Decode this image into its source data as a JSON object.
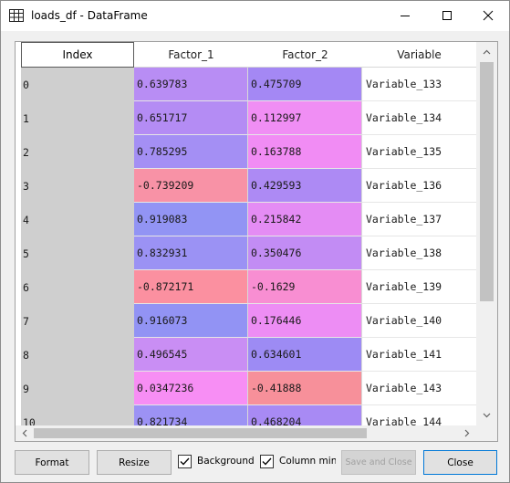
{
  "window": {
    "title": "loads_df - DataFrame"
  },
  "icons": {
    "app": "table-grid-icon",
    "minimize": "minimize-icon",
    "maximize": "maximize-icon",
    "close": "close-icon"
  },
  "table": {
    "index_header": "Index",
    "columns": [
      "Factor_1",
      "Factor_2",
      "Variable"
    ],
    "rows": [
      {
        "index": "0",
        "factor_1": "0.639783",
        "factor_2": "0.475709",
        "variable": "Variable_133",
        "color_1": "#b88df4",
        "color_2": "#a488f4"
      },
      {
        "index": "1",
        "factor_1": "0.651717",
        "factor_2": "0.112997",
        "variable": "Variable_134",
        "color_1": "#b48cf4",
        "color_2": "#f08ef4"
      },
      {
        "index": "2",
        "factor_1": "0.785295",
        "factor_2": "0.163788",
        "variable": "Variable_135",
        "color_1": "#a48ff4",
        "color_2": "#f18cf4"
      },
      {
        "index": "3",
        "factor_1": "-0.739209",
        "factor_2": "0.429593",
        "variable": "Variable_136",
        "color_1": "#f892a6",
        "color_2": "#ad8af4"
      },
      {
        "index": "4",
        "factor_1": "0.919083",
        "factor_2": "0.215842",
        "variable": "Variable_137",
        "color_1": "#9294f4",
        "color_2": "#e48cf4"
      },
      {
        "index": "5",
        "factor_1": "0.832931",
        "factor_2": "0.350476",
        "variable": "Variable_138",
        "color_1": "#9b92f4",
        "color_2": "#c28cf4"
      },
      {
        "index": "6",
        "factor_1": "-0.872171",
        "factor_2": "-0.1629",
        "variable": "Variable_139",
        "color_1": "#fb90a0",
        "color_2": "#f88ed2"
      },
      {
        "index": "7",
        "factor_1": "0.916073",
        "factor_2": "0.176446",
        "variable": "Variable_140",
        "color_1": "#9293f4",
        "color_2": "#ed8df4"
      },
      {
        "index": "8",
        "factor_1": "0.496545",
        "factor_2": "0.634601",
        "variable": "Variable_141",
        "color_1": "#c98ef4",
        "color_2": "#9d8bf4"
      },
      {
        "index": "9",
        "factor_1": "0.0347236",
        "factor_2": "-0.41888",
        "variable": "Variable_143",
        "color_1": "#f78ef4",
        "color_2": "#f7909a"
      },
      {
        "index": "10",
        "factor_1": "0.821734",
        "factor_2": "0.468204",
        "variable": "Variable_144",
        "color_1": "#9c92f4",
        "color_2": "#a88af4"
      }
    ]
  },
  "buttons": {
    "format": "Format",
    "resize": "Resize",
    "save_and_close": "Save and Close",
    "close": "Close"
  },
  "checkboxes": {
    "background": {
      "label": "Background",
      "checked": true
    },
    "column_minmax": {
      "label": "Column min/",
      "checked": true
    }
  }
}
